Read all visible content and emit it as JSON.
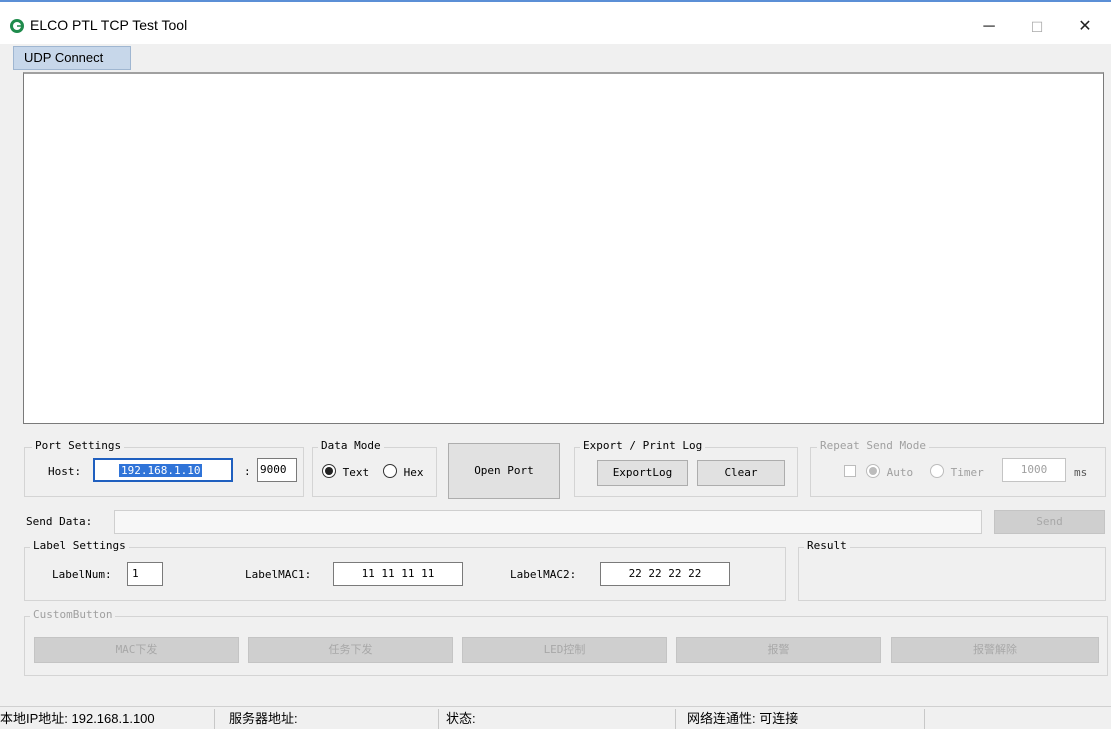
{
  "window": {
    "title": "ELCO PTL TCP Test Tool",
    "minimize": "─",
    "maximize": "☐",
    "close": "✕"
  },
  "tab": {
    "label": "UDP Connect"
  },
  "port_settings": {
    "title": "Port Settings",
    "host_label": "Host:",
    "host_value": "192.168.1.10",
    "colon": ":",
    "port_value": "9000"
  },
  "data_mode": {
    "title": "Data Mode",
    "text_label": "Text",
    "hex_label": "Hex",
    "selected": "Text"
  },
  "open_port": {
    "label": "Open Port"
  },
  "export_log": {
    "title": "Export / Print Log",
    "export_label": "ExportLog",
    "clear_label": "Clear"
  },
  "repeat_send": {
    "title": "Repeat Send Mode",
    "auto_label": "Auto",
    "timer_label": "Timer",
    "interval_value": "1000",
    "unit": "ms"
  },
  "send": {
    "label": "Send Data:",
    "value": "",
    "button": "Send"
  },
  "label_settings": {
    "title": "Label Settings",
    "num_label": "LabelNum:",
    "num_value": "1",
    "mac1_label": "LabelMAC1:",
    "mac1_value": "11 11 11 11",
    "mac2_label": "LabelMAC2:",
    "mac2_value": "22 22 22 22"
  },
  "result": {
    "title": "Result"
  },
  "custom_buttons": {
    "title": "CustomButton",
    "buttons": [
      "MAC下发",
      "任务下发",
      "LED控制",
      "报警",
      "报警解除"
    ]
  },
  "status_bar": {
    "local_ip": "本地IP地址: 192.168.1.100",
    "server_addr": "服务器地址:",
    "state": "状态:",
    "network": "网络连通性: 可连接"
  }
}
